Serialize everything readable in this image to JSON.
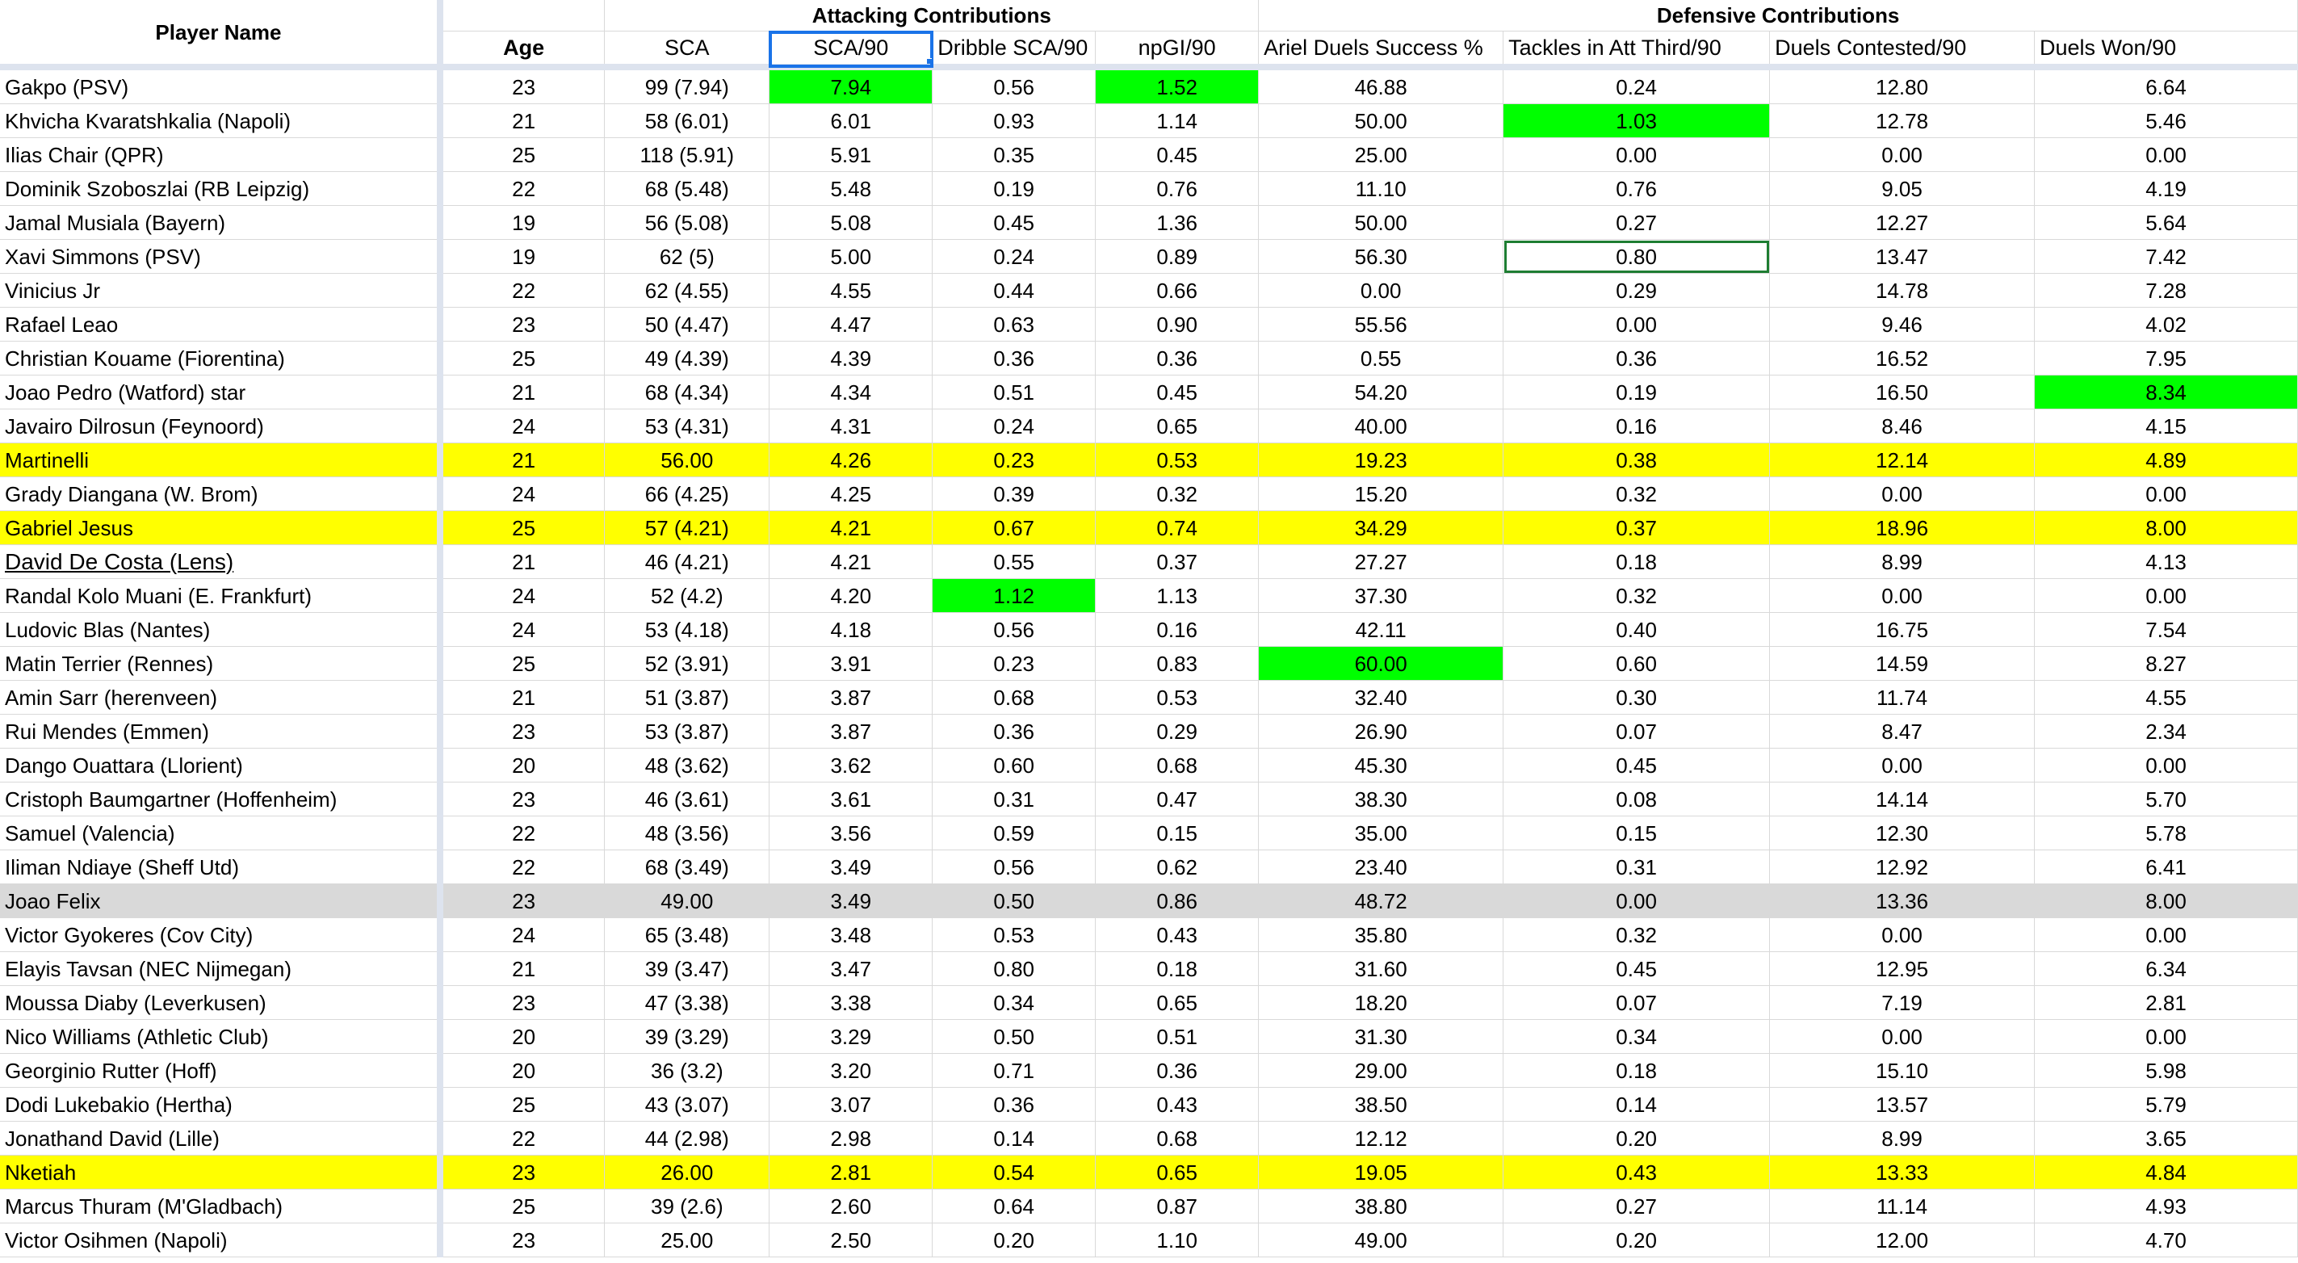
{
  "group_headers": {
    "player_name": "Player Name",
    "attacking": "Attacking Contributions",
    "defensive": "Defensive Contributions"
  },
  "columns": [
    "Age",
    "SCA",
    "SCA/90",
    "Dribble SCA/90",
    "npGI/90",
    "Ariel Duels Success %",
    "Tackles in Att Third/90",
    "Duels Contested/90",
    "Duels Won/90"
  ],
  "colors": {
    "highlight_green": "#00ff00",
    "highlight_yellow": "#ffff00",
    "highlight_gray": "#d9d9d9",
    "selection_blue": "#1a73e8"
  },
  "rows": [
    {
      "name": "Gakpo (PSV)",
      "cells": [
        "23",
        "99 (7.94)",
        "7.94",
        "0.56",
        "1.52",
        "46.88",
        "0.24",
        "12.80",
        "6.64"
      ],
      "green": [
        2,
        4
      ]
    },
    {
      "name": "Khvicha Kvaratshkalia (Napoli)",
      "cells": [
        "21",
        "58 (6.01)",
        "6.01",
        "0.93",
        "1.14",
        "50.00",
        "1.03",
        "12.78",
        "5.46"
      ],
      "green": [
        6
      ]
    },
    {
      "name": "Ilias Chair (QPR)",
      "cells": [
        "25",
        "118 (5.91)",
        "5.91",
        "0.35",
        "0.45",
        "25.00",
        "0.00",
        "0.00",
        "0.00"
      ]
    },
    {
      "name": "Dominik Szoboszlai (RB Leipzig)",
      "cells": [
        "22",
        "68 (5.48)",
        "5.48",
        "0.19",
        "0.76",
        "11.10",
        "0.76",
        "9.05",
        "4.19"
      ]
    },
    {
      "name": "Jamal Musiala (Bayern)",
      "cells": [
        "19",
        "56 (5.08)",
        "5.08",
        "0.45",
        "1.36",
        "50.00",
        "0.27",
        "12.27",
        "5.64"
      ]
    },
    {
      "name": "Xavi Simmons (PSV)",
      "cells": [
        "19",
        "62 (5)",
        "5.00",
        "0.24",
        "0.89",
        "56.30",
        "0.80",
        "13.47",
        "7.42"
      ],
      "boxed": [
        6
      ]
    },
    {
      "name": "Vinicius Jr",
      "cells": [
        "22",
        "62 (4.55)",
        "4.55",
        "0.44",
        "0.66",
        "0.00",
        "0.29",
        "14.78",
        "7.28"
      ]
    },
    {
      "name": "Rafael Leao",
      "cells": [
        "23",
        "50 (4.47)",
        "4.47",
        "0.63",
        "0.90",
        "55.56",
        "0.00",
        "9.46",
        "4.02"
      ]
    },
    {
      "name": "Christian Kouame (Fiorentina)",
      "cells": [
        "25",
        "49 (4.39)",
        "4.39",
        "0.36",
        "0.36",
        "0.55",
        "0.36",
        "16.52",
        "7.95"
      ]
    },
    {
      "name": "Joao Pedro (Watford) star",
      "cells": [
        "21",
        "68 (4.34)",
        "4.34",
        "0.51",
        "0.45",
        "54.20",
        "0.19",
        "16.50",
        "8.34"
      ],
      "green": [
        8
      ]
    },
    {
      "name": "Javairo Dilrosun (Feynoord)",
      "cells": [
        "24",
        "53 (4.31)",
        "4.31",
        "0.24",
        "0.65",
        "40.00",
        "0.16",
        "8.46",
        "4.15"
      ]
    },
    {
      "name": "Martinelli",
      "cells": [
        "21",
        "56.00",
        "4.26",
        "0.23",
        "0.53",
        "19.23",
        "0.38",
        "12.14",
        "4.89"
      ],
      "row": "yellow"
    },
    {
      "name": "Grady Diangana (W. Brom)",
      "cells": [
        "24",
        "66 (4.25)",
        "4.25",
        "0.39",
        "0.32",
        "15.20",
        "0.32",
        "0.00",
        "0.00"
      ]
    },
    {
      "name": "Gabriel Jesus",
      "cells": [
        "25",
        "57 (4.21)",
        "4.21",
        "0.67",
        "0.74",
        "34.29",
        "0.37",
        "18.96",
        "8.00"
      ],
      "row": "yellow",
      "green": [
        7
      ]
    },
    {
      "name": "David De Costa (Lens)",
      "cells": [
        "21",
        "46 (4.21)",
        "4.21",
        "0.55",
        "0.37",
        "27.27",
        "0.18",
        "8.99",
        "4.13"
      ],
      "underline": true
    },
    {
      "name": "Randal Kolo Muani (E. Frankfurt)",
      "cells": [
        "24",
        "52 (4.2)",
        "4.20",
        "1.12",
        "1.13",
        "37.30",
        "0.32",
        "0.00",
        "0.00"
      ],
      "green": [
        3
      ]
    },
    {
      "name": "Ludovic Blas (Nantes)",
      "cells": [
        "24",
        "53 (4.18)",
        "4.18",
        "0.56",
        "0.16",
        "42.11",
        "0.40",
        "16.75",
        "7.54"
      ]
    },
    {
      "name": "Matin Terrier (Rennes)",
      "cells": [
        "25",
        "52 (3.91)",
        "3.91",
        "0.23",
        "0.83",
        "60.00",
        "0.60",
        "14.59",
        "8.27"
      ],
      "green": [
        5
      ]
    },
    {
      "name": "Amin Sarr (herenveen)",
      "cells": [
        "21",
        "51 (3.87)",
        "3.87",
        "0.68",
        "0.53",
        "32.40",
        "0.30",
        "11.74",
        "4.55"
      ]
    },
    {
      "name": "Rui Mendes (Emmen)",
      "cells": [
        "23",
        "53 (3.87)",
        "3.87",
        "0.36",
        "0.29",
        "26.90",
        "0.07",
        "8.47",
        "2.34"
      ]
    },
    {
      "name": "Dango Ouattara (Llorient)",
      "cells": [
        "20",
        "48 (3.62)",
        "3.62",
        "0.60",
        "0.68",
        "45.30",
        "0.45",
        "0.00",
        "0.00"
      ]
    },
    {
      "name": "Cristoph Baumgartner (Hoffenheim)",
      "cells": [
        "23",
        "46 (3.61)",
        "3.61",
        "0.31",
        "0.47",
        "38.30",
        "0.08",
        "14.14",
        "5.70"
      ]
    },
    {
      "name": "Samuel (Valencia)",
      "cells": [
        "22",
        "48 (3.56)",
        "3.56",
        "0.59",
        "0.15",
        "35.00",
        "0.15",
        "12.30",
        "5.78"
      ]
    },
    {
      "name": "Iliman Ndiaye (Sheff Utd)",
      "cells": [
        "22",
        "68 (3.49)",
        "3.49",
        "0.56",
        "0.62",
        "23.40",
        "0.31",
        "12.92",
        "6.41"
      ]
    },
    {
      "name": "Joao Felix",
      "cells": [
        "23",
        "49.00",
        "3.49",
        "0.50",
        "0.86",
        "48.72",
        "0.00",
        "13.36",
        "8.00"
      ],
      "row": "gray"
    },
    {
      "name": "Victor Gyokeres (Cov City)",
      "cells": [
        "24",
        "65 (3.48)",
        "3.48",
        "0.53",
        "0.43",
        "35.80",
        "0.32",
        "0.00",
        "0.00"
      ]
    },
    {
      "name": "Elayis Tavsan (NEC Nijmegan)",
      "cells": [
        "21",
        "39 (3.47)",
        "3.47",
        "0.80",
        "0.18",
        "31.60",
        "0.45",
        "12.95",
        "6.34"
      ]
    },
    {
      "name": "Moussa Diaby (Leverkusen)",
      "cells": [
        "23",
        "47 (3.38)",
        "3.38",
        "0.34",
        "0.65",
        "18.20",
        "0.07",
        "7.19",
        "2.81"
      ]
    },
    {
      "name": "Nico Williams (Athletic Club)",
      "cells": [
        "20",
        "39 (3.29)",
        "3.29",
        "0.50",
        "0.51",
        "31.30",
        "0.34",
        "0.00",
        "0.00"
      ]
    },
    {
      "name": "Georginio Rutter (Hoff)",
      "cells": [
        "20",
        "36 (3.2)",
        "3.20",
        "0.71",
        "0.36",
        "29.00",
        "0.18",
        "15.10",
        "5.98"
      ]
    },
    {
      "name": "Dodi Lukebakio (Hertha)",
      "cells": [
        "25",
        "43 (3.07)",
        "3.07",
        "0.36",
        "0.43",
        "38.50",
        "0.14",
        "13.57",
        "5.79"
      ]
    },
    {
      "name": "Jonathand David (Lille)",
      "cells": [
        "22",
        "44 (2.98)",
        "2.98",
        "0.14",
        "0.68",
        "12.12",
        "0.20",
        "8.99",
        "3.65"
      ]
    },
    {
      "name": "Nketiah",
      "cells": [
        "23",
        "26.00",
        "2.81",
        "0.54",
        "0.65",
        "19.05",
        "0.43",
        "13.33",
        "4.84"
      ],
      "row": "yellow"
    },
    {
      "name": "Marcus Thuram (M'Gladbach)",
      "cells": [
        "25",
        "39 (2.6)",
        "2.60",
        "0.64",
        "0.87",
        "38.80",
        "0.27",
        "11.14",
        "4.93"
      ]
    },
    {
      "name": "Victor Osihmen (Napoli)",
      "cells": [
        "23",
        "25.00",
        "2.50",
        "0.20",
        "1.10",
        "49.00",
        "0.20",
        "12.00",
        "4.70"
      ]
    }
  ]
}
